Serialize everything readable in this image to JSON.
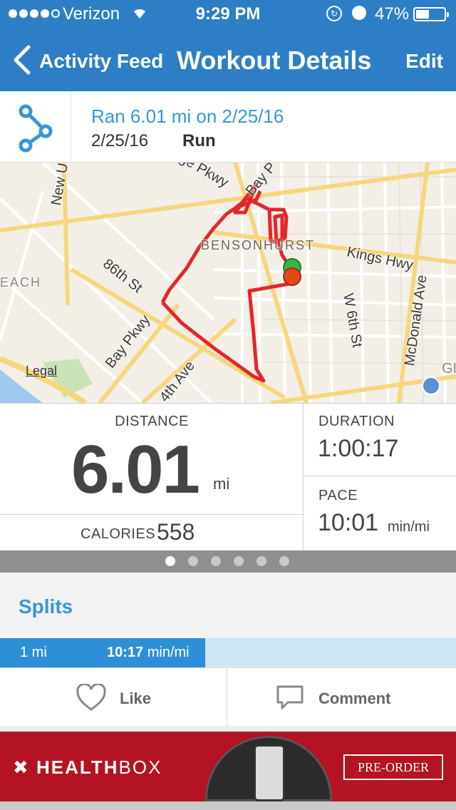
{
  "status_bar": {
    "carrier": "Verizon",
    "time": "9:29 PM",
    "battery": "47%",
    "battery_level": 0.47,
    "signal_bars": 4
  },
  "nav": {
    "back_label": "Activity Feed",
    "title": "Workout Details",
    "edit_label": "Edit"
  },
  "workout": {
    "title": "Ran 6.01 mi on 2/25/16",
    "date": "2/25/16",
    "type": "Run",
    "icon": "route-icon"
  },
  "map": {
    "labels": {
      "new_utrecht": "New U",
      "parkway_top": "ge Pkwy",
      "bay_top": "Bay P",
      "bensonhurst": "BENSONHURST",
      "kings_hwy": "Kings Hwy",
      "beach": "EACH",
      "st86": "86th St",
      "w6th": "W 6th St",
      "mcdonald": "McDonald Ave",
      "bay_pkwy": "Bay Pkwy",
      "ave14": "4th Ave",
      "gr": "GI"
    },
    "legal": "Legal"
  },
  "stats": {
    "distance_label": "DISTANCE",
    "distance_value": "6.01",
    "distance_unit": "mi",
    "calories_label": "CALORIES",
    "calories_value": "558",
    "duration_label": "DURATION",
    "duration_value": "1:00:17",
    "pace_label": "PACE",
    "pace_value": "10:01",
    "pace_unit": "min/mi"
  },
  "pager": {
    "pages": 6,
    "active": 0
  },
  "splits": {
    "title": "Splits",
    "rows": [
      {
        "mile": "1 mi",
        "pace": "10:17",
        "unit": "min/mi",
        "fraction": 0.45
      }
    ]
  },
  "actions": {
    "like_label": "Like",
    "comment_label": "Comment"
  },
  "ad": {
    "brand_bold": "HEALTH",
    "brand_thin": "BOX",
    "cta": "PRE-ORDER"
  },
  "colors": {
    "primary": "#2d7ec5",
    "link": "#3797d5",
    "route": "#e3262b",
    "ad_red": "#b31322"
  }
}
